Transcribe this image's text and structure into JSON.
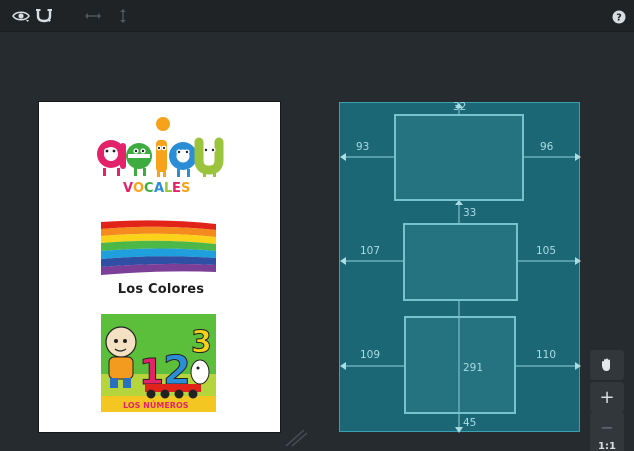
{
  "toolbar": {
    "buttons": [
      {
        "name": "eye-icon",
        "active": true
      },
      {
        "name": "magnet-icon",
        "active": true
      },
      {
        "name": "horizontal-distribute-icon",
        "active": false
      },
      {
        "name": "vertical-distribute-icon",
        "active": false
      }
    ],
    "help_icon": "help-icon"
  },
  "preview": {
    "logos": [
      {
        "name": "aeiou-vocales-logo",
        "letters": "aeiou",
        "subtitle": "VOCALES"
      },
      {
        "name": "los-colores-logo",
        "caption": "Los Colores"
      },
      {
        "name": "numeros-logo",
        "digits": "123",
        "caption": "LOS NÚMEROS"
      }
    ]
  },
  "layout": {
    "margins": {
      "slot1": {
        "top": "32",
        "left": "93",
        "right": "96"
      },
      "slot2": {
        "top": "33",
        "left": "107",
        "right": "105"
      },
      "slot3": {
        "left": "109",
        "right": "110",
        "center": "291",
        "bottom": "45"
      }
    }
  },
  "tools": {
    "hand_icon": "hand-icon",
    "zoom_in": "+",
    "zoom_out": "−",
    "actual_size": "1:1"
  },
  "colors": {
    "background": "#262b2f",
    "toolbar": "#1f2326",
    "layout_fill": "#1b6776",
    "layout_line": "#74c3cd"
  }
}
